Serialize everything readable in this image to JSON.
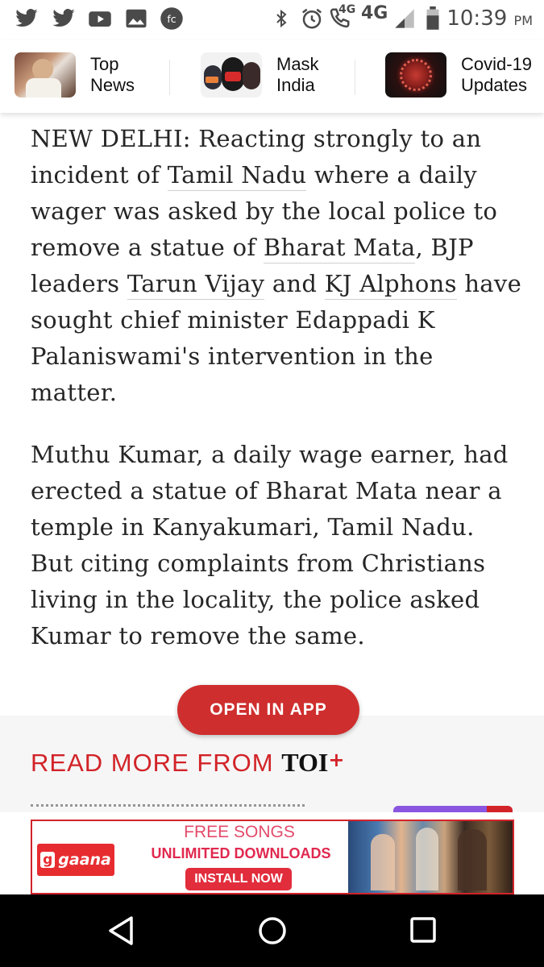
{
  "status_bar": {
    "time": "10:39",
    "ampm": "PM",
    "network_small": "4G",
    "network": "4G",
    "left_icons": [
      "twitter-icon",
      "twitter-icon",
      "youtube-icon",
      "gallery-icon",
      "fc-icon"
    ],
    "right_icons": [
      "bluetooth-icon",
      "alarm-icon",
      "volte-call-icon",
      "signal-icon",
      "battery-icon"
    ]
  },
  "top_nav": {
    "items": [
      {
        "label_line1": "Top",
        "label_line2": "News"
      },
      {
        "label_line1": "Mask",
        "label_line2": "India"
      },
      {
        "label_line1": "Covid-19",
        "label_line2": "Updates"
      }
    ]
  },
  "article": {
    "p1": {
      "t1": "NEW DELHI: Reacting strongly to an incident of ",
      "link1": "Tamil Nadu",
      "t2": " where a daily wager was asked by the local police to remove a statue of ",
      "link2": "Bharat Mata",
      "t3": ", BJP leaders ",
      "link3": "Tarun Vijay",
      "t4": " and ",
      "link4": "KJ Alphons",
      "t5": " have sought chief minister Edappadi K Palaniswami's intervention in the matter."
    },
    "p2": "Muthu Kumar, a daily wage earner, had erected a statue of Bharat Mata near a temple in Kanyakumari, Tamil Nadu. But citing complaints from Christians living in the locality, the police asked Kumar to remove the same."
  },
  "open_app_button": "OPEN IN APP",
  "read_more": {
    "label": "READ MORE FROM",
    "brand": "TOI",
    "brand_plus": "+"
  },
  "ad": {
    "brand_badge": "g",
    "brand": "gaana",
    "line1": "FREE SONGS",
    "line2": "UNLIMITED DOWNLOADS",
    "cta": "INSTALL NOW"
  },
  "colors": {
    "accent_red": "#d22328",
    "button_red": "#cf2e2e",
    "text": "#262626"
  }
}
